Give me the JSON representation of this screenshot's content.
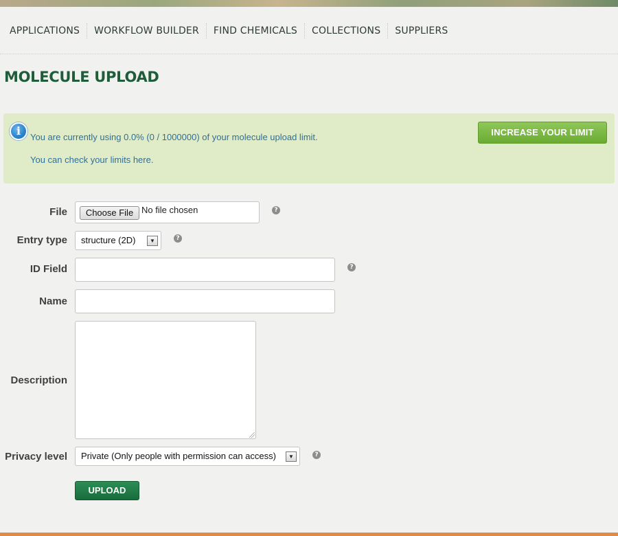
{
  "nav": {
    "items": [
      "APPLICATIONS",
      "WORKFLOW BUILDER",
      "FIND CHEMICALS",
      "COLLECTIONS",
      "SUPPLIERS"
    ]
  },
  "page": {
    "title": "MOLECULE UPLOAD"
  },
  "info": {
    "usage_text": "You are currently using 0.0% (0 / 1000000) of your molecule upload limit.",
    "limits_prefix": "You can check your limits ",
    "limits_link": "here",
    "limits_suffix": ".",
    "increase_label": "INCREASE YOUR LIMIT",
    "icon": "info-icon"
  },
  "form": {
    "file_label": "File",
    "choose_file_label": "Choose File",
    "no_file_text": "No file chosen",
    "entry_type_label": "Entry type",
    "entry_type_value": "structure (2D)",
    "id_field_label": "ID Field",
    "id_field_value": "",
    "name_label": "Name",
    "name_value": "",
    "description_label": "Description",
    "description_value": "",
    "privacy_label": "Privacy level",
    "privacy_value": "Private (Only people with permission can access)",
    "upload_label": "UPLOAD",
    "help_glyph": "?"
  },
  "colors": {
    "title_green": "#1f5d3a",
    "info_bg": "#e0ecc8",
    "info_text": "#2f6f96",
    "increase_btn": "#7ab945",
    "upload_btn": "#1f7a45",
    "bottom_bar": "#e08a43"
  }
}
